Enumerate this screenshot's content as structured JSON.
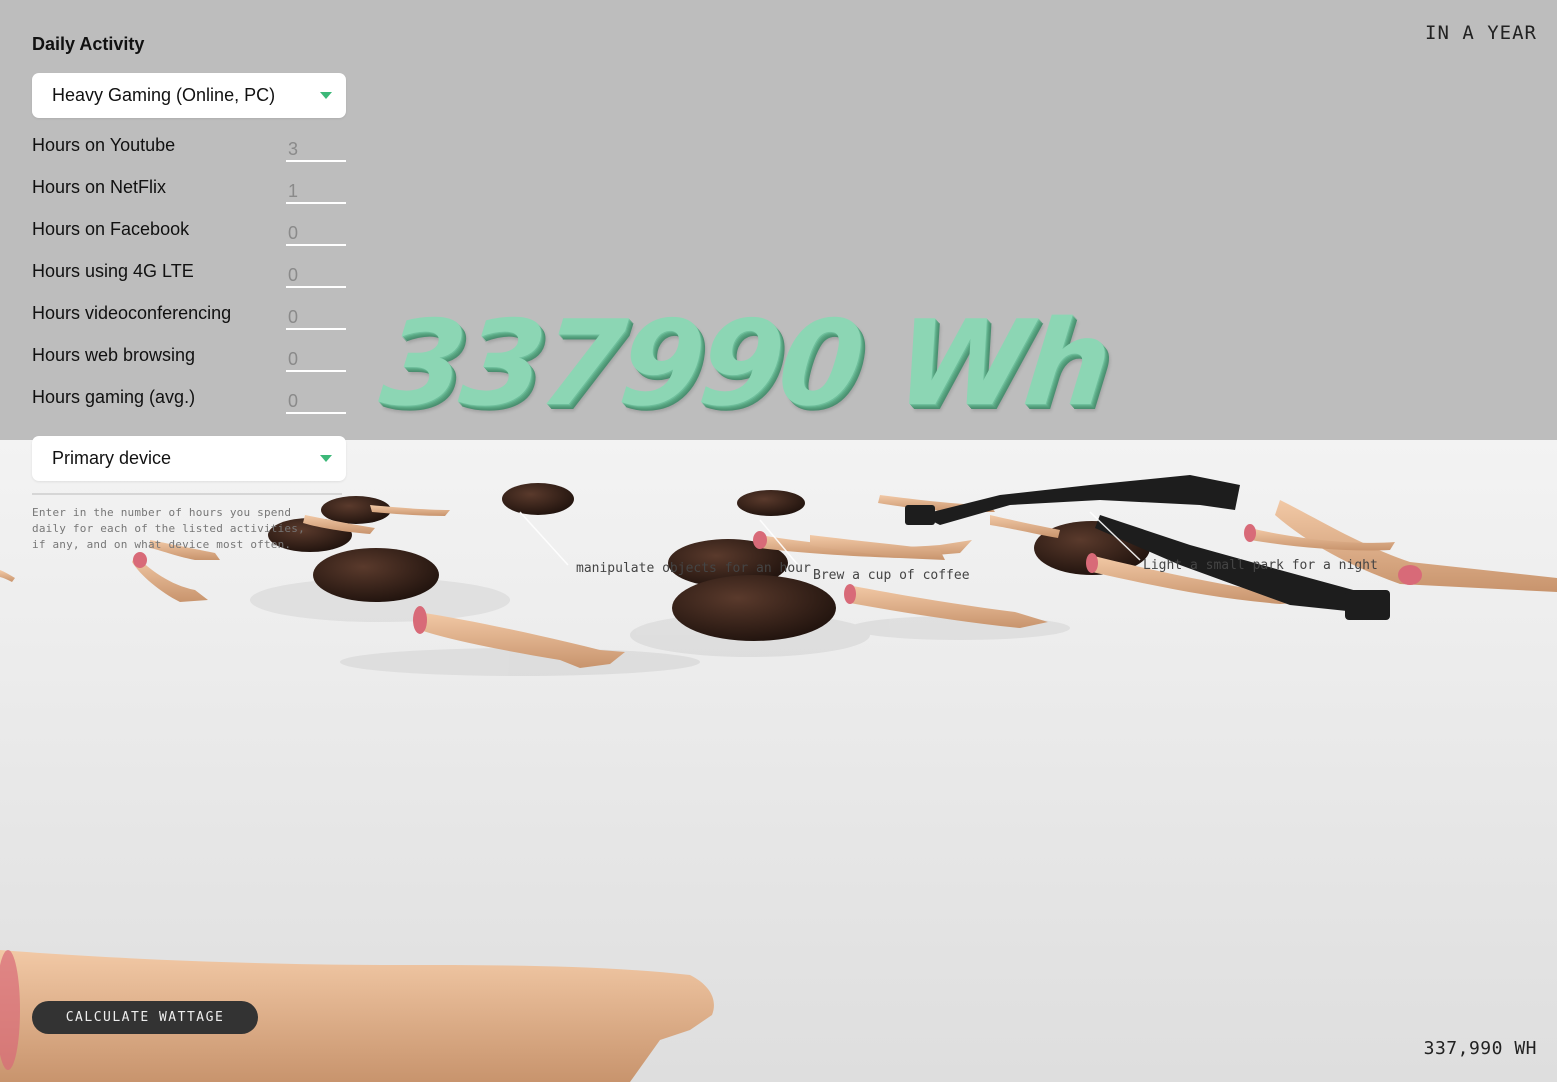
{
  "panel": {
    "title": "Daily Activity",
    "activity_selected": "Heavy Gaming (Online, PC)",
    "fields": [
      {
        "label": "Hours on Youtube",
        "value": "3"
      },
      {
        "label": "Hours on NetFlix",
        "value": "1"
      },
      {
        "label": "Hours on Facebook",
        "value": "0"
      },
      {
        "label": "Hours using 4G LTE",
        "value": "0"
      },
      {
        "label": "Hours videoconferencing",
        "value": "0"
      },
      {
        "label": "Hours web browsing",
        "value": "0"
      },
      {
        "label": "Hours gaming (avg.)",
        "value": "0"
      }
    ],
    "device_selected": "Primary device",
    "helper_text": "Enter in the number of hours you spend daily for each of the listed activities, if any, and on what device most often."
  },
  "header": {
    "period_label": "IN A YEAR"
  },
  "scene": {
    "big_number": "337990 Wh",
    "labels": [
      "manipulate objects for an hour",
      "Brew a cup of coffee",
      "Light a small park for a night"
    ]
  },
  "footer": {
    "calculate_label": "CALCULATE WATTAGE",
    "total_label": "337,990 WH"
  },
  "colors": {
    "accent": "#3cb878",
    "number": "#8cd6b4"
  }
}
